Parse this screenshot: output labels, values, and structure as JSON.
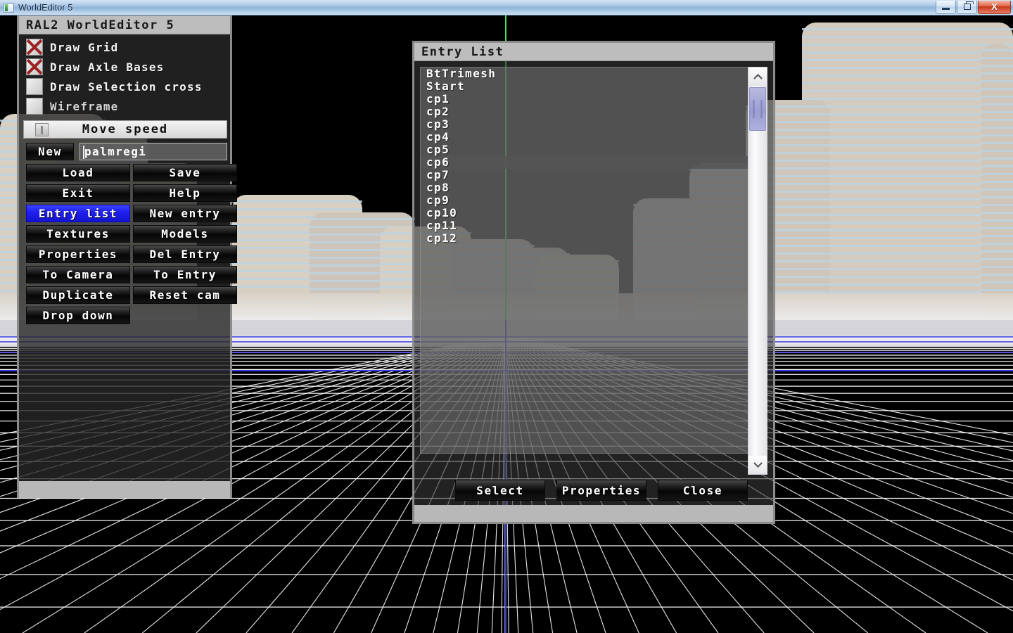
{
  "os_window": {
    "title": "WorldEditor 5",
    "icon": "app-icon",
    "buttons": [
      {
        "name": "minimize",
        "glyph": "minimize-icon"
      },
      {
        "name": "restore",
        "glyph": "restore-icon"
      },
      {
        "name": "close",
        "glyph": "close-icon",
        "label": "X"
      }
    ]
  },
  "panel": {
    "title": "RAL2 WorldEditor 5",
    "checkboxes": [
      {
        "label": "Draw Grid",
        "checked": true
      },
      {
        "label": "Draw Axle Bases",
        "checked": true
      },
      {
        "label": "Draw Selection cross",
        "checked": false
      },
      {
        "label": "Wireframe",
        "checked": false
      }
    ],
    "slider": {
      "label": "Move speed",
      "value": 6
    },
    "new_button": "New",
    "filename_field": {
      "value": "palmregi",
      "placeholder": ""
    },
    "buttons": [
      "Load",
      "Save",
      "Exit",
      "Help",
      "Entry list",
      "New entry",
      "Textures",
      "Models",
      "Properties",
      "Del Entry",
      "To Camera",
      "To Entry",
      "Duplicate",
      "Reset cam"
    ],
    "selected_button": "Entry list",
    "dropdown_button": "Drop down"
  },
  "dialog": {
    "title": "Entry List",
    "entries": [
      "BtTrimesh",
      "Start",
      "cp1",
      "cp2",
      "cp3",
      "cp4",
      "cp5",
      "cp6",
      "cp7",
      "cp8",
      "cp9",
      "cp10",
      "cp11",
      "cp12"
    ],
    "selected_entry": "cp6",
    "scrollbar": {
      "up_icon": "chevron-up-icon",
      "down_icon": "chevron-down-icon"
    },
    "buttons": [
      "Select",
      "Properties",
      "Close"
    ]
  },
  "viewport": {
    "description": "3D city scene with perspective grid floor",
    "colors": {
      "sky": "#000000",
      "building": "#d8cfc3",
      "window_band": "#bcd3e2",
      "grid_line": "#ffffff",
      "haze": "#e4e4ea",
      "axis_y": "#44e05a",
      "axis_z": "#3a3ae0"
    },
    "axes": {
      "y_axis": "green-vertical-line",
      "z_axis": "blue-vertical-line"
    }
  }
}
